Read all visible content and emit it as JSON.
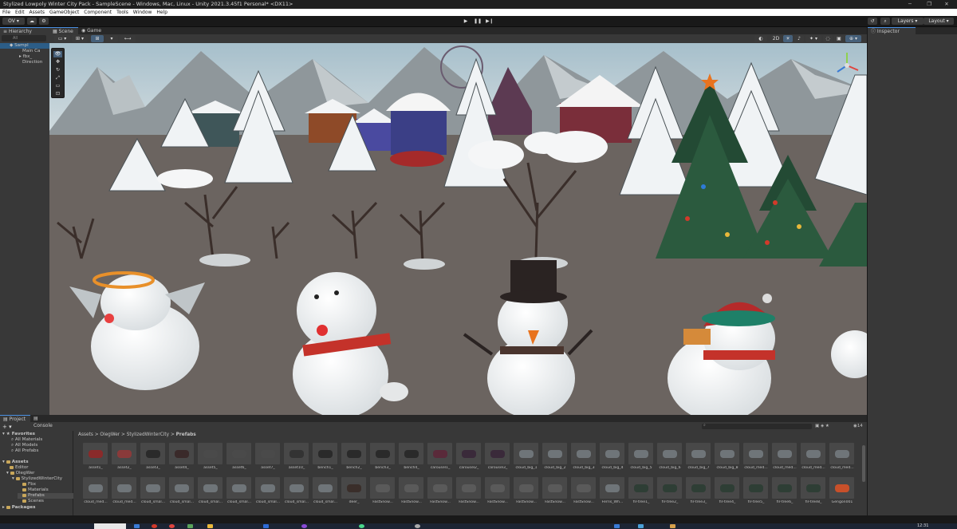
{
  "window": {
    "title": "Stylized Lowpoly Winter City Pack - SampleScene - Windows, Mac, Linux - Unity 2021.3.45f1 Personal* <DX11>",
    "controls": [
      "─",
      "❐",
      "✕"
    ]
  },
  "menu": [
    "File",
    "Edit",
    "Assets",
    "GameObject",
    "Component",
    "Tools",
    "Window",
    "Help"
  ],
  "toolbar": {
    "account": "OV",
    "play_icons": [
      "▶",
      "❚❚",
      "▶❙"
    ],
    "layers_label": "Layers",
    "layout_label": "Layout"
  },
  "hierarchy": {
    "tab": "Hierarchy",
    "search_placeholder": "All",
    "items": [
      "Sampl",
      "Main Ca",
      "fbx_",
      "Direction"
    ]
  },
  "scene": {
    "tabs": [
      "Scene",
      "Game"
    ],
    "mode_2d": "2D"
  },
  "inspector": {
    "tab": "Inspector"
  },
  "project": {
    "tabs": [
      "Project",
      "Console"
    ],
    "breadcrumb": [
      "Assets",
      "OlegWer",
      "StylizedWinterCity",
      "Prefabs"
    ],
    "count": "14",
    "favorites": {
      "label": "Favorites",
      "items": [
        "All Materials",
        "All Models",
        "All Prefabs"
      ]
    },
    "assets_tree": {
      "label": "Assets",
      "items": [
        "Editor",
        "OlegWer",
        "StylizedWinterCity",
        "Fbx",
        "Materials",
        "Prefabs",
        "Scenes"
      ]
    },
    "packages_label": "Packages",
    "row1": [
      "asset1_",
      "asset2_",
      "asset3_",
      "asset4_",
      "asset5_",
      "asset6_",
      "asset7_",
      "asset10_",
      "bench1_",
      "bench2_",
      "bench3_",
      "bench4_",
      "carousel1_",
      "carousel2_",
      "carousel3_",
      "cloud_big_1",
      "cloud_big_2",
      "cloud_big_3",
      "cloud_big_4",
      "cloud_big_5",
      "cloud_big_6",
      "cloud_big_7",
      "cloud_big_8",
      "cloud_med...",
      "cloud_med...",
      "cloud_med...",
      "cloud_med..."
    ],
    "row2": [
      "cloud_med...",
      "cloud_med...",
      "cloud_smal...",
      "cloud_smal...",
      "cloud_smal...",
      "cloud_smal...",
      "cloud_smal...",
      "cloud_smal...",
      "cloud_smal...",
      "deer_",
      "FastSnow...",
      "FastSnow...",
      "FastSnow...",
      "FastSnow...",
      "FastSnow...",
      "FastSnow...",
      "FastSnow...",
      "FastSnow...",
      "Ferris_Wh...",
      "fir-tree1_",
      "fir-tree2_",
      "fir-tree3_",
      "fir-tree4_",
      "fir-tree5_",
      "fir-tree6_",
      "fir-tree8_",
      "Gengon001"
    ]
  },
  "clock": "12:31"
}
